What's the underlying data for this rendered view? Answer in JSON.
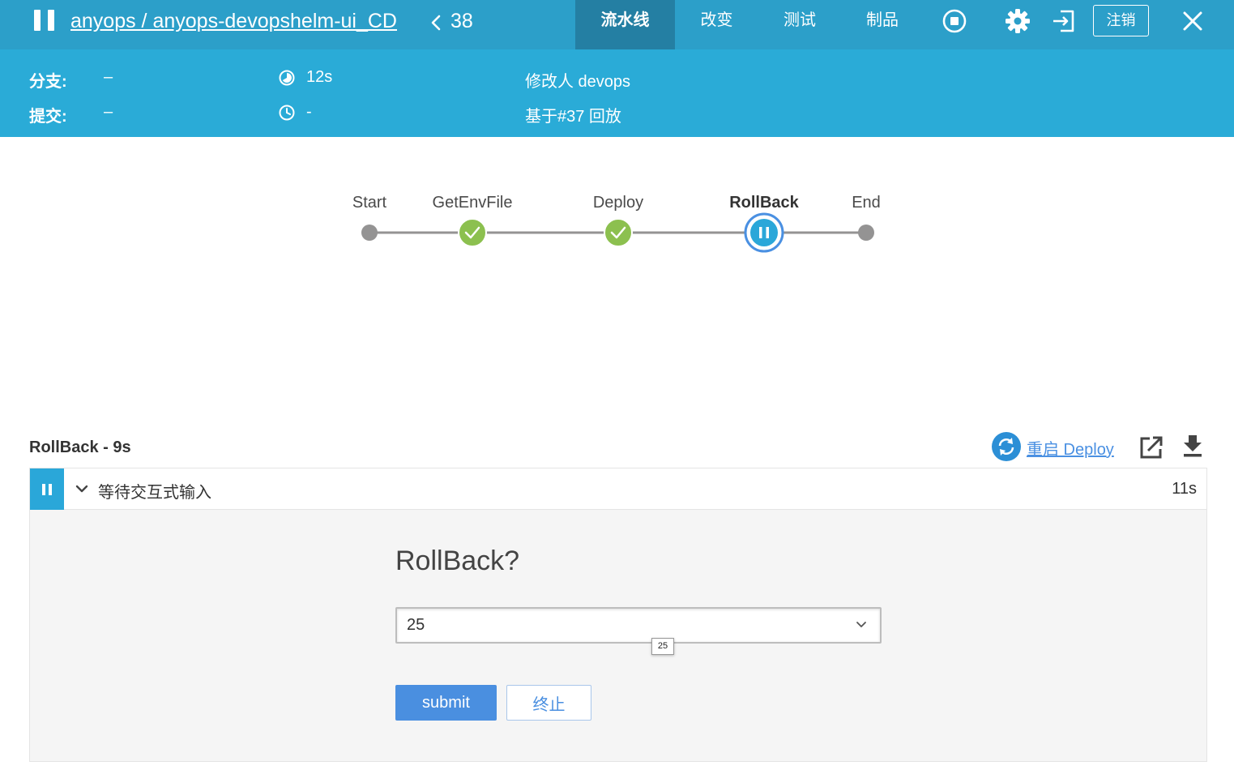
{
  "header": {
    "breadcrumb": "anyops / anyops-devopshelm-ui_CD",
    "run_number": "38",
    "tabs": [
      {
        "label": "流水线",
        "active": true
      },
      {
        "label": "改变",
        "active": false
      },
      {
        "label": "测试",
        "active": false
      },
      {
        "label": "制品",
        "active": false
      }
    ],
    "logout_label": "注销",
    "icons": [
      "pause-icon",
      "chevron-left-icon",
      "stop-icon",
      "gear-icon",
      "exit-icon",
      "close-icon"
    ]
  },
  "info": {
    "branch_label": "分支:",
    "branch_value": "–",
    "commit_label": "提交:",
    "commit_value": "–",
    "duration": "12s",
    "started": "-",
    "changed_by": "修改人 devops",
    "replay_of": "基于#37 回放"
  },
  "pipeline": {
    "stages": [
      {
        "name": "Start",
        "status": "start"
      },
      {
        "name": "GetEnvFile",
        "status": "success"
      },
      {
        "name": "Deploy",
        "status": "success"
      },
      {
        "name": "RollBack",
        "status": "paused"
      },
      {
        "name": "End",
        "status": "end"
      }
    ],
    "colors": {
      "success": "#8cc04f",
      "paused": "#2aa7d9",
      "node": "#949393",
      "line": "#949393",
      "ring": "#4a90e2"
    }
  },
  "stage_panel": {
    "title": "RollBack - 9s",
    "restart_label": "重启 Deploy",
    "step": {
      "title": "等待交互式输入",
      "duration": "11s"
    },
    "input": {
      "prompt": "RollBack?",
      "selected_value": "25",
      "tooltip": "25",
      "submit_label": "submit",
      "abort_label": "终止"
    }
  }
}
